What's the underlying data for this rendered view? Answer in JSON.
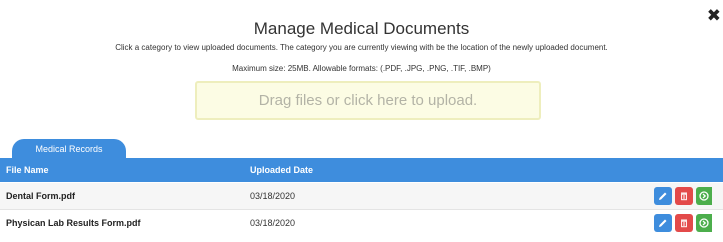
{
  "modal": {
    "title": "Manage Medical Documents",
    "close_icon": "✖",
    "description": "Click a category to view uploaded documents. The category you are currently viewing with be the location of the newly uploaded document.",
    "formats": "Maximum size: 25MB. Allowable formats: (.PDF, .JPG, .PNG, .TIF, .BMP)",
    "dropzone_label": "Drag files or click here to upload."
  },
  "tabs": [
    {
      "label": "Medical Records"
    }
  ],
  "table": {
    "columns": [
      "File Name",
      "Uploaded Date"
    ],
    "rows": [
      {
        "file_name": "Dental Form.pdf",
        "uploaded_date": "03/18/2020"
      },
      {
        "file_name": "Physican Lab Results Form.pdf",
        "uploaded_date": "03/18/2020"
      }
    ]
  },
  "icons": {
    "edit": "pencil-icon",
    "delete": "trash-icon",
    "view": "arrow-circle-icon"
  },
  "colors": {
    "accent": "#3e8ddd",
    "delete": "#e34a4a",
    "view": "#4cae4c",
    "dropzone_bg": "#fcfce4"
  }
}
